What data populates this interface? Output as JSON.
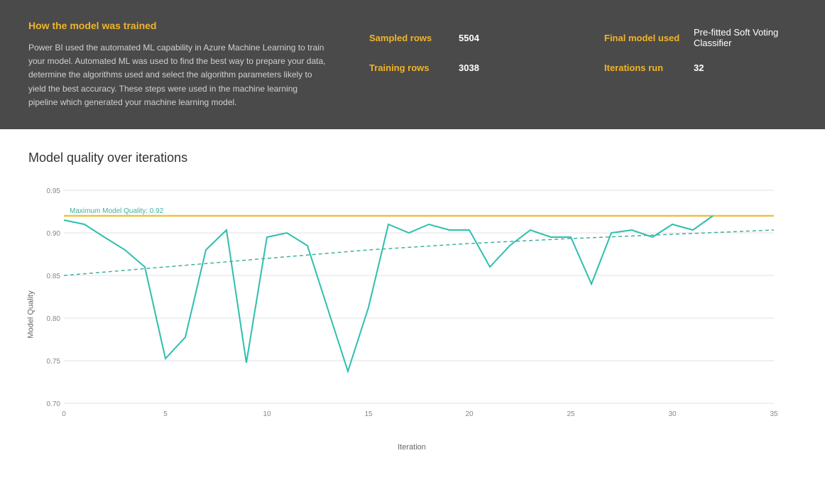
{
  "header": {
    "title": "How the model was trained",
    "description": "Power BI used the automated ML capability in Azure Machine Learning to train your model. Automated ML was used to find the best way to prepare your data, determine the algorithms used and select the algorithm parameters likely to yield the best accuracy. These steps were used in the machine learning pipeline which generated your machine learning model.",
    "stats": {
      "sampled_rows_label": "Sampled rows",
      "sampled_rows_value": "5504",
      "training_rows_label": "Training rows",
      "training_rows_value": "3038",
      "final_model_label": "Final model used",
      "final_model_value": "Pre-fitted Soft Voting Classifier",
      "iterations_label": "Iterations run",
      "iterations_value": "32"
    }
  },
  "chart": {
    "title": "Model quality over iterations",
    "y_label": "Model Quality",
    "x_label": "Iteration",
    "max_quality_label": "Maximum Model Quality: 0.92",
    "y_ticks": [
      "0.95",
      "0.90",
      "0.85",
      "0.80",
      "0.75",
      "0.70"
    ],
    "x_ticks": [
      "0",
      "5",
      "10",
      "15",
      "20",
      "25",
      "30",
      "35"
    ]
  }
}
